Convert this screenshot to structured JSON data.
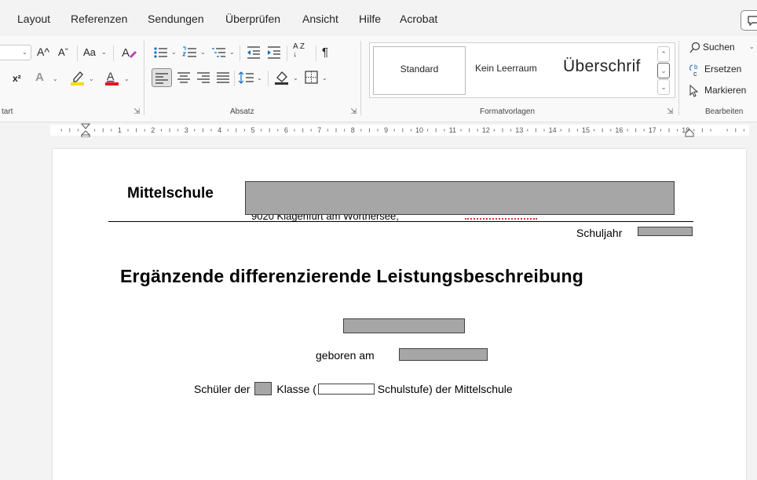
{
  "menu": {
    "tabs": [
      "Layout",
      "Referenzen",
      "Sendungen",
      "Überprüfen",
      "Ansicht",
      "Hilfe",
      "Acrobat"
    ]
  },
  "ribbon": {
    "font_group": {
      "label": "tart",
      "grow_font": "A^",
      "shrink_font": "Aˇ",
      "case": "Aa",
      "superscript": "x²",
      "text_effects": "A",
      "highlight_color": "#f2e000",
      "font_color": "#e81123",
      "font_color_letter": "A"
    },
    "paragraph_group": {
      "label": "Absatz",
      "sort_glyph": "A Z ↓",
      "pilcrow": "¶"
    },
    "styles_group": {
      "label": "Formatvorlagen",
      "styles": [
        "Standard",
        "Kein Leerraum",
        "Überschrif"
      ]
    },
    "editing_group": {
      "label": "Bearbeiten",
      "search": "Suchen",
      "replace": "Ersetzen",
      "select": "Markieren"
    }
  },
  "ruler": {
    "numbers": [
      "1",
      "2",
      "3",
      "4",
      "5",
      "6",
      "7",
      "8",
      "9",
      "10",
      "11",
      "12",
      "13",
      "14",
      "15",
      "16",
      "17",
      "18"
    ]
  },
  "document": {
    "school_title": "Mittelschule",
    "address_fragment": "9020 Klagenfurt am Wörthersee,",
    "school_year_label": "Schuljahr",
    "heading": "Ergänzende differenzierende Leistungsbeschreibung",
    "born_label": "geboren am",
    "pupil_prefix": "Schüler der",
    "class_word": "Klasse (",
    "level_word": "Schulstufe) der Mittelschule"
  }
}
